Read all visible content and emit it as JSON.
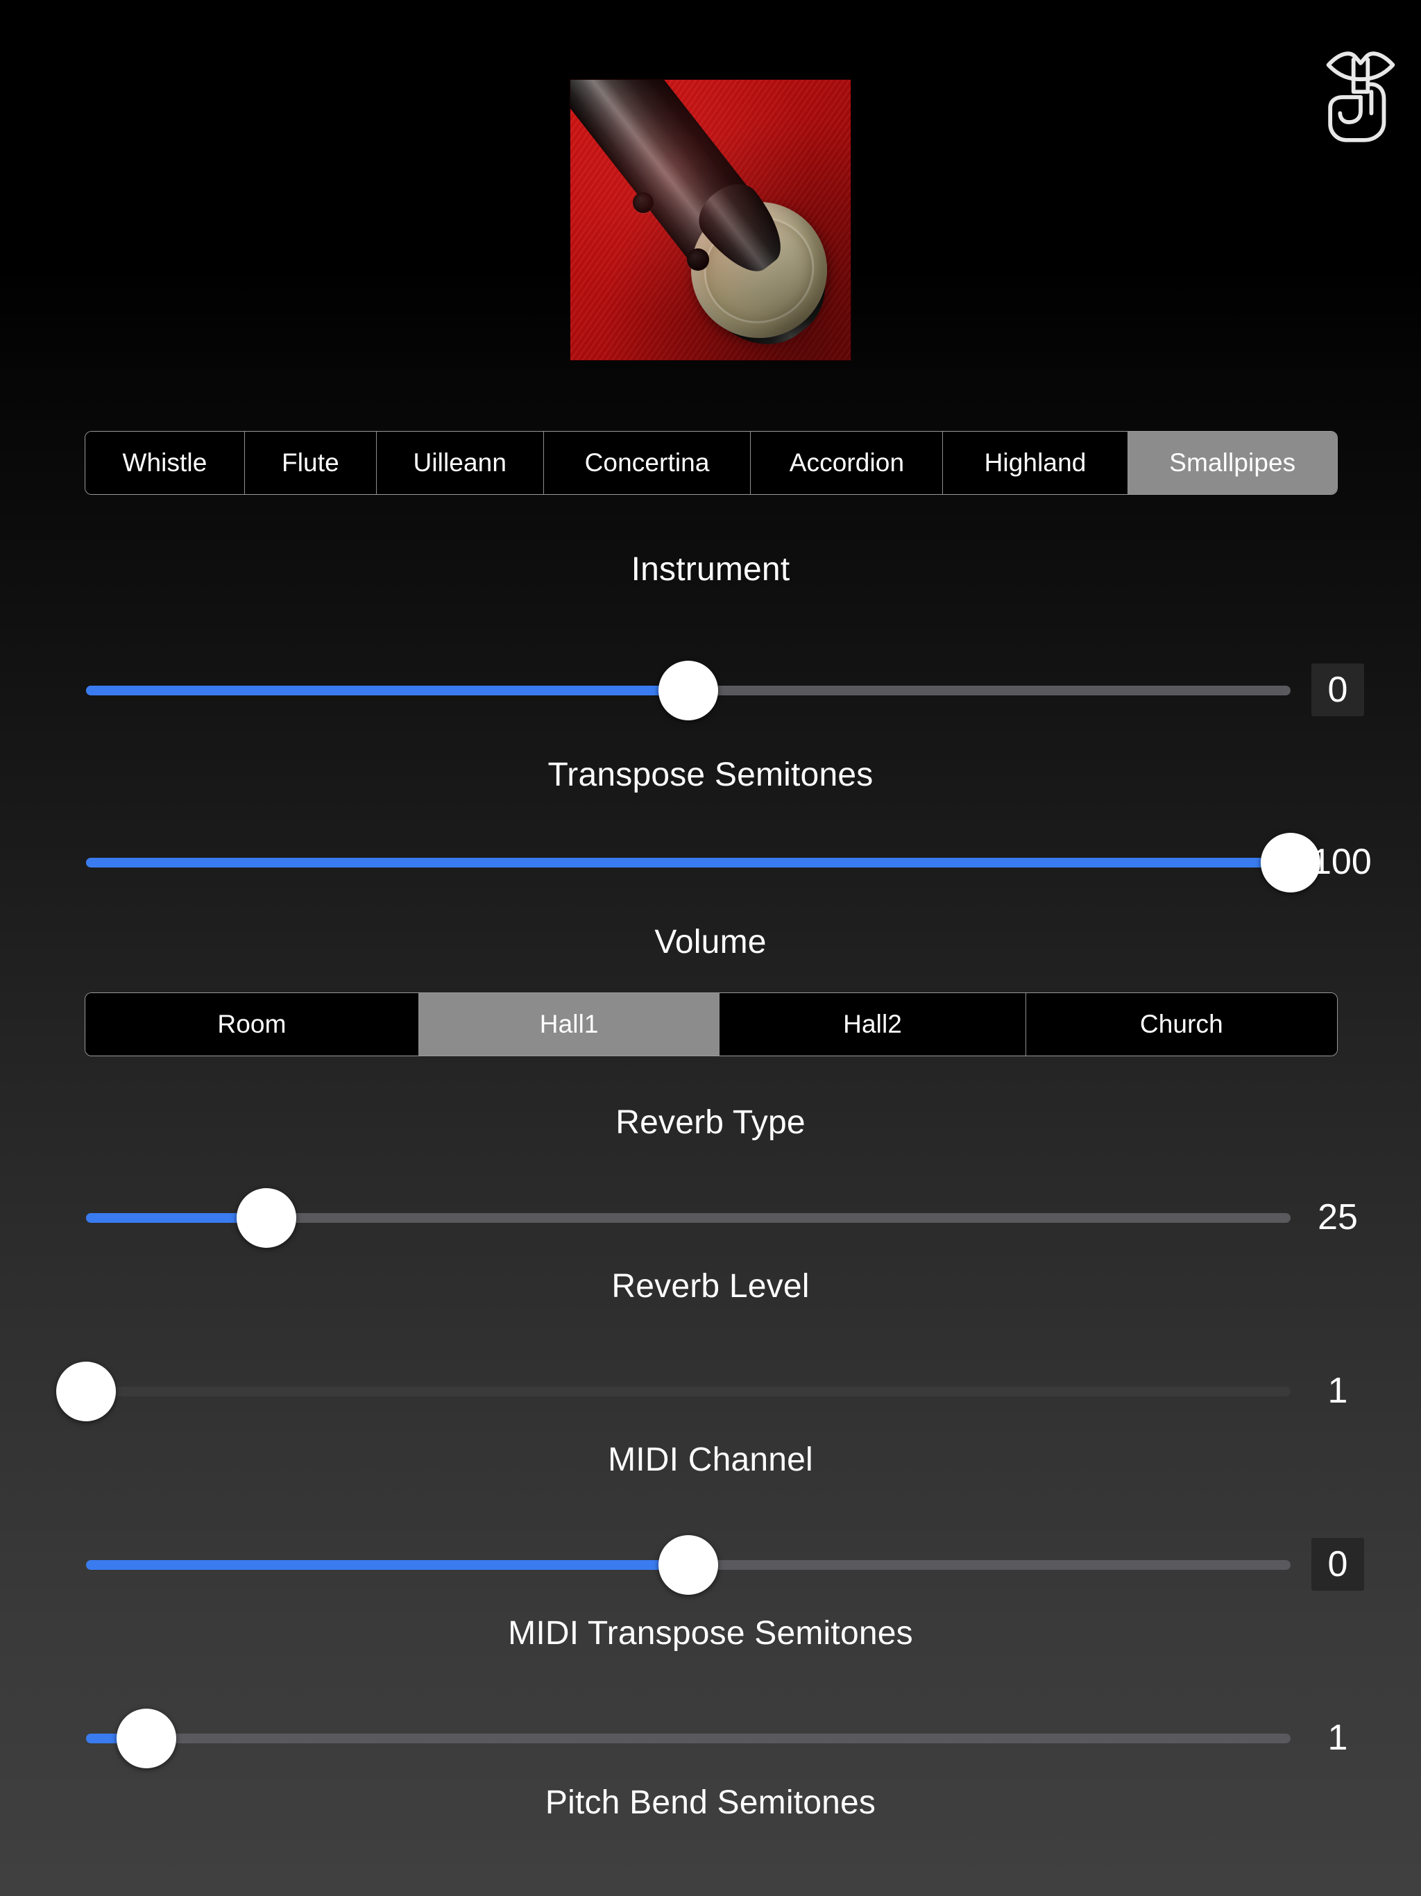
{
  "app": {
    "logo_icon": "shush-finger-on-lips-icon",
    "artwork_alt": "smallpipes-chanter-artwork"
  },
  "instrument_control": {
    "label": "Instrument",
    "options": [
      "Whistle",
      "Flute",
      "Uilleann",
      "Concertina",
      "Accordion",
      "Highland",
      "Smallpipes"
    ],
    "selected": "Smallpipes",
    "selected_index": 6
  },
  "reverb_control": {
    "label": "Reverb Type",
    "options": [
      "Room",
      "Hall1",
      "Hall2",
      "Church"
    ],
    "selected": "Hall1",
    "selected_index": 1
  },
  "sliders": [
    {
      "name": "transpose-semitones",
      "label": "Transpose Semitones",
      "value": "0",
      "percent": 50,
      "boxed_value": true,
      "filled": true
    },
    {
      "name": "volume",
      "label": "Volume",
      "value": "100",
      "percent": 100,
      "boxed_value": false,
      "filled": true
    },
    {
      "name": "reverb-level",
      "label": "Reverb Level",
      "value": "25",
      "percent": 15,
      "boxed_value": false,
      "filled": true
    },
    {
      "name": "midi-channel",
      "label": "MIDI Channel",
      "value": "1",
      "percent": 0,
      "boxed_value": false,
      "filled": false
    },
    {
      "name": "midi-transpose-semitones",
      "label": "MIDI Transpose Semitones",
      "value": "0",
      "percent": 50,
      "boxed_value": true,
      "filled": true
    },
    {
      "name": "pitch-bend-semitones",
      "label": "Pitch Bend Semitones",
      "value": "1",
      "percent": 5,
      "boxed_value": false,
      "filled": true
    }
  ],
  "colors": {
    "accent_blue": "#3a7cf0",
    "selected_segment": "#8c8c8c",
    "track": "#5a5a5e",
    "thumb": "#ffffff",
    "artwork_red": "#b50d0d"
  }
}
